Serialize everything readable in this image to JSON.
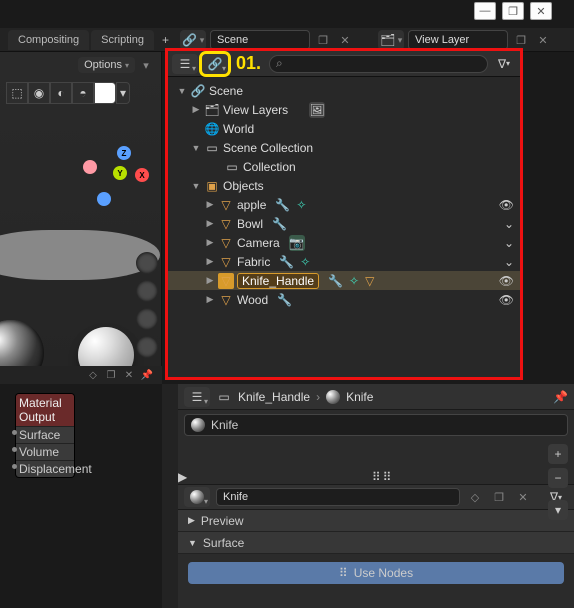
{
  "window": {
    "min": "—",
    "max": "❐",
    "close": "✕"
  },
  "top_tabs": {
    "compositing": "Compositing",
    "scripting": "Scripting"
  },
  "header": {
    "scene_label": "Scene",
    "viewlayer_label": "View Layer"
  },
  "options_label": "Options",
  "annotation": "01.",
  "search_placeholder": "",
  "tree": {
    "scene": "Scene",
    "view_layers": "View Layers",
    "world": "World",
    "scene_collection": "Scene Collection",
    "collection": "Collection",
    "objects": "Objects",
    "items": {
      "apple": "apple",
      "bowl": "Bowl",
      "camera": "Camera",
      "fabric": "Fabric",
      "knife_handle": "Knife_Handle",
      "wood": "Wood"
    }
  },
  "props": {
    "object_name": "Knife_Handle",
    "material_name": "Knife",
    "slot_name": "Knife",
    "matname_field": "Knife",
    "preview": "Preview",
    "surface": "Surface",
    "use_nodes": "Use Nodes"
  },
  "node": {
    "title": "Material Output",
    "r1": "Surface",
    "r2": "Volume",
    "r3": "Displacement"
  }
}
